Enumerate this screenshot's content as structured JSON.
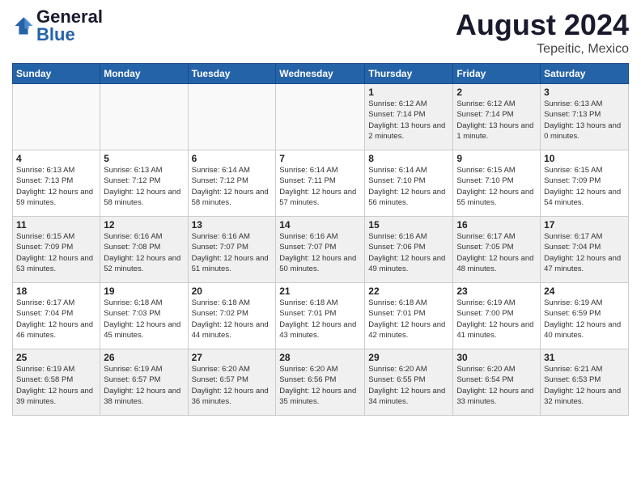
{
  "header": {
    "logo_text_general": "General",
    "logo_text_blue": "Blue",
    "month_year": "August 2024",
    "location": "Tepeitic, Mexico"
  },
  "days_of_week": [
    "Sunday",
    "Monday",
    "Tuesday",
    "Wednesday",
    "Thursday",
    "Friday",
    "Saturday"
  ],
  "weeks": [
    [
      {
        "day": "",
        "empty": true
      },
      {
        "day": "",
        "empty": true
      },
      {
        "day": "",
        "empty": true
      },
      {
        "day": "",
        "empty": true
      },
      {
        "day": "1",
        "sunrise": "6:12 AM",
        "sunset": "7:14 PM",
        "daylight": "13 hours and 2 minutes."
      },
      {
        "day": "2",
        "sunrise": "6:12 AM",
        "sunset": "7:14 PM",
        "daylight": "13 hours and 1 minute."
      },
      {
        "day": "3",
        "sunrise": "6:13 AM",
        "sunset": "7:13 PM",
        "daylight": "13 hours and 0 minutes."
      }
    ],
    [
      {
        "day": "4",
        "sunrise": "6:13 AM",
        "sunset": "7:13 PM",
        "daylight": "12 hours and 59 minutes."
      },
      {
        "day": "5",
        "sunrise": "6:13 AM",
        "sunset": "7:12 PM",
        "daylight": "12 hours and 58 minutes."
      },
      {
        "day": "6",
        "sunrise": "6:14 AM",
        "sunset": "7:12 PM",
        "daylight": "12 hours and 58 minutes."
      },
      {
        "day": "7",
        "sunrise": "6:14 AM",
        "sunset": "7:11 PM",
        "daylight": "12 hours and 57 minutes."
      },
      {
        "day": "8",
        "sunrise": "6:14 AM",
        "sunset": "7:10 PM",
        "daylight": "12 hours and 56 minutes."
      },
      {
        "day": "9",
        "sunrise": "6:15 AM",
        "sunset": "7:10 PM",
        "daylight": "12 hours and 55 minutes."
      },
      {
        "day": "10",
        "sunrise": "6:15 AM",
        "sunset": "7:09 PM",
        "daylight": "12 hours and 54 minutes."
      }
    ],
    [
      {
        "day": "11",
        "sunrise": "6:15 AM",
        "sunset": "7:09 PM",
        "daylight": "12 hours and 53 minutes."
      },
      {
        "day": "12",
        "sunrise": "6:16 AM",
        "sunset": "7:08 PM",
        "daylight": "12 hours and 52 minutes."
      },
      {
        "day": "13",
        "sunrise": "6:16 AM",
        "sunset": "7:07 PM",
        "daylight": "12 hours and 51 minutes."
      },
      {
        "day": "14",
        "sunrise": "6:16 AM",
        "sunset": "7:07 PM",
        "daylight": "12 hours and 50 minutes."
      },
      {
        "day": "15",
        "sunrise": "6:16 AM",
        "sunset": "7:06 PM",
        "daylight": "12 hours and 49 minutes."
      },
      {
        "day": "16",
        "sunrise": "6:17 AM",
        "sunset": "7:05 PM",
        "daylight": "12 hours and 48 minutes."
      },
      {
        "day": "17",
        "sunrise": "6:17 AM",
        "sunset": "7:04 PM",
        "daylight": "12 hours and 47 minutes."
      }
    ],
    [
      {
        "day": "18",
        "sunrise": "6:17 AM",
        "sunset": "7:04 PM",
        "daylight": "12 hours and 46 minutes."
      },
      {
        "day": "19",
        "sunrise": "6:18 AM",
        "sunset": "7:03 PM",
        "daylight": "12 hours and 45 minutes."
      },
      {
        "day": "20",
        "sunrise": "6:18 AM",
        "sunset": "7:02 PM",
        "daylight": "12 hours and 44 minutes."
      },
      {
        "day": "21",
        "sunrise": "6:18 AM",
        "sunset": "7:01 PM",
        "daylight": "12 hours and 43 minutes."
      },
      {
        "day": "22",
        "sunrise": "6:18 AM",
        "sunset": "7:01 PM",
        "daylight": "12 hours and 42 minutes."
      },
      {
        "day": "23",
        "sunrise": "6:19 AM",
        "sunset": "7:00 PM",
        "daylight": "12 hours and 41 minutes."
      },
      {
        "day": "24",
        "sunrise": "6:19 AM",
        "sunset": "6:59 PM",
        "daylight": "12 hours and 40 minutes."
      }
    ],
    [
      {
        "day": "25",
        "sunrise": "6:19 AM",
        "sunset": "6:58 PM",
        "daylight": "12 hours and 39 minutes."
      },
      {
        "day": "26",
        "sunrise": "6:19 AM",
        "sunset": "6:57 PM",
        "daylight": "12 hours and 38 minutes."
      },
      {
        "day": "27",
        "sunrise": "6:20 AM",
        "sunset": "6:57 PM",
        "daylight": "12 hours and 36 minutes."
      },
      {
        "day": "28",
        "sunrise": "6:20 AM",
        "sunset": "6:56 PM",
        "daylight": "12 hours and 35 minutes."
      },
      {
        "day": "29",
        "sunrise": "6:20 AM",
        "sunset": "6:55 PM",
        "daylight": "12 hours and 34 minutes."
      },
      {
        "day": "30",
        "sunrise": "6:20 AM",
        "sunset": "6:54 PM",
        "daylight": "12 hours and 33 minutes."
      },
      {
        "day": "31",
        "sunrise": "6:21 AM",
        "sunset": "6:53 PM",
        "daylight": "12 hours and 32 minutes."
      }
    ]
  ]
}
